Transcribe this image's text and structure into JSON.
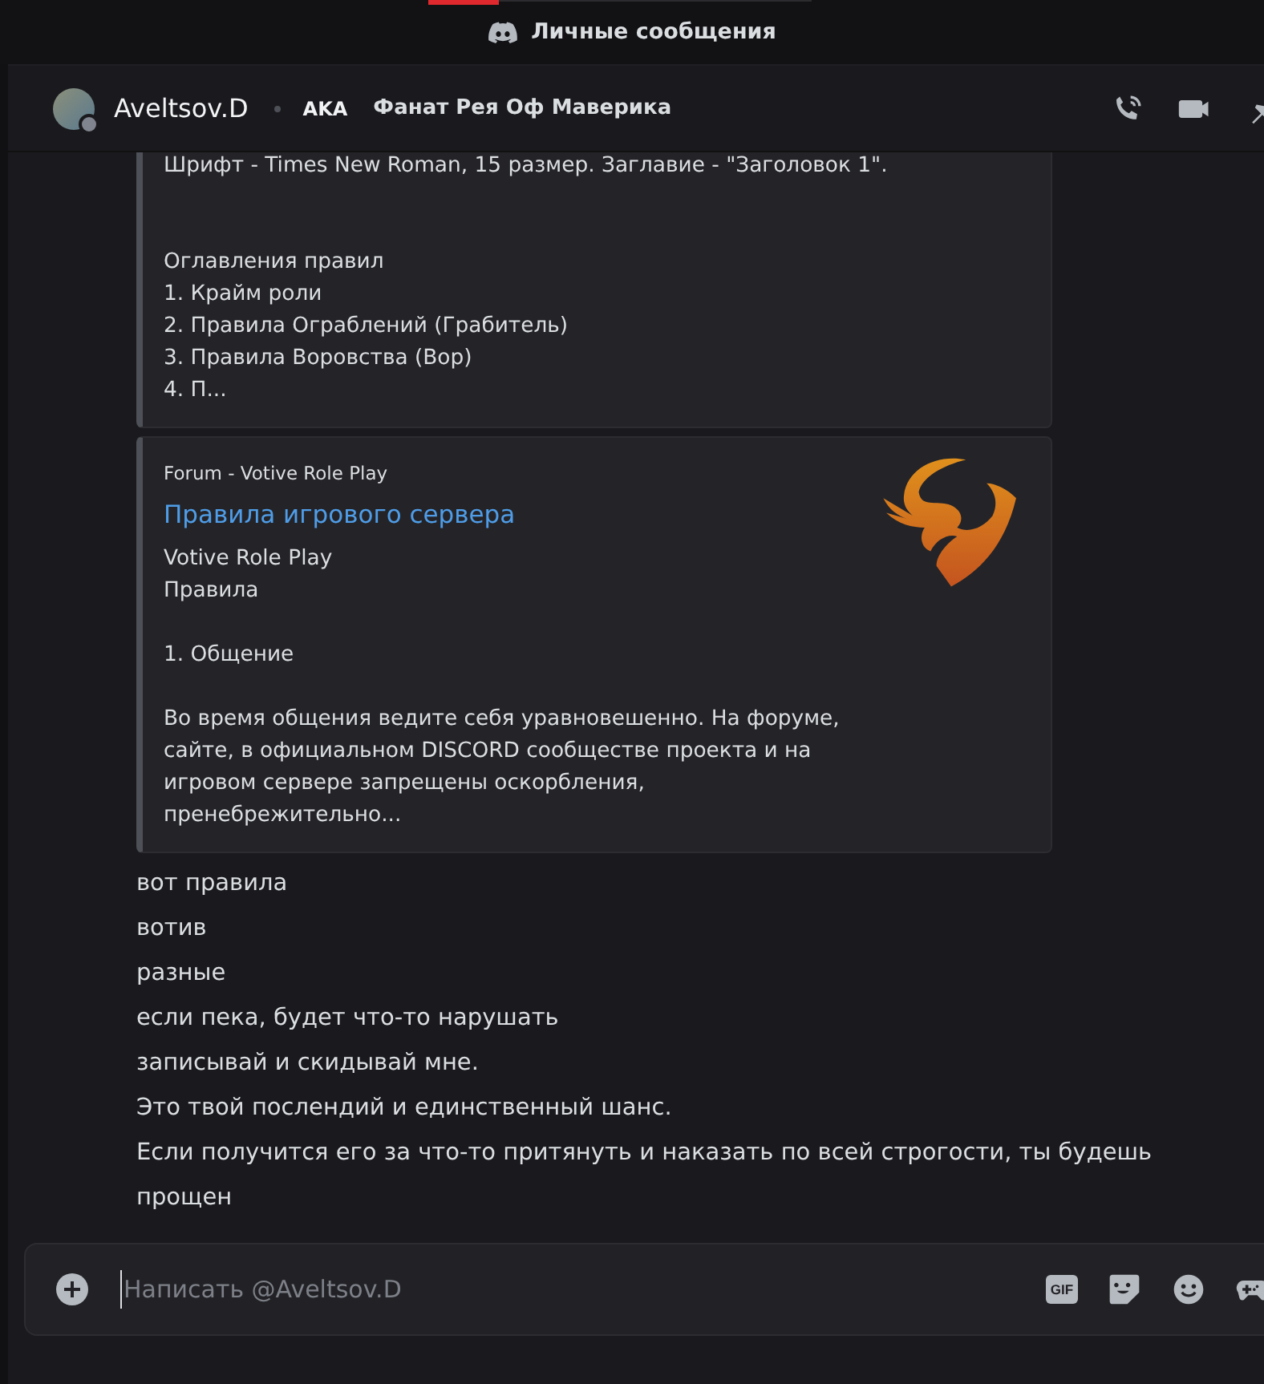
{
  "window": {
    "title": "Личные сообщения"
  },
  "header": {
    "username": "Aveltsov.D",
    "aka_label": "AKA",
    "aka_name": "Фанат Рея Оф Маверика"
  },
  "embeds": [
    {
      "kind": "text",
      "wide_gaps": true,
      "paragraphs": [
        [
          "Шрифт - Times New Roman, 15 размер. Заглавие - \"Заголовок 1\"."
        ],
        [
          "Оглавления правил",
          "1. Крайм роли",
          "2. Правила Ограблений (Грабитель)",
          "3. Правила Воровства (Вор)",
          "4. П..."
        ]
      ]
    },
    {
      "kind": "link",
      "wide_gaps": false,
      "provider": "Forum - Votive Role Play",
      "title": "Правила игрового сервера",
      "paragraphs": [
        [
          "Votive Role Play",
          "Правила"
        ],
        [
          "1. Общение"
        ],
        [
          "Во время общения ведите себя уравновешенно. На форуме,",
          "сайте, в официальном DISCORD сообществе проекта и на",
          "игровом сервере запрещены оскорбления,",
          "пренебрежительно..."
        ]
      ]
    }
  ],
  "messages": [
    "вот правила",
    "вотив",
    "разные",
    "если пека, будет что-то нарушать",
    "записывай и скидывай мне.",
    "Это твой послендий и единственный шанс.",
    "Если получится его за что-то притянуть и наказать по всей строгости, ты будешь прощен"
  ],
  "composer": {
    "placeholder": "Написать @Aveltsov.D",
    "gif_label": "GIF"
  }
}
